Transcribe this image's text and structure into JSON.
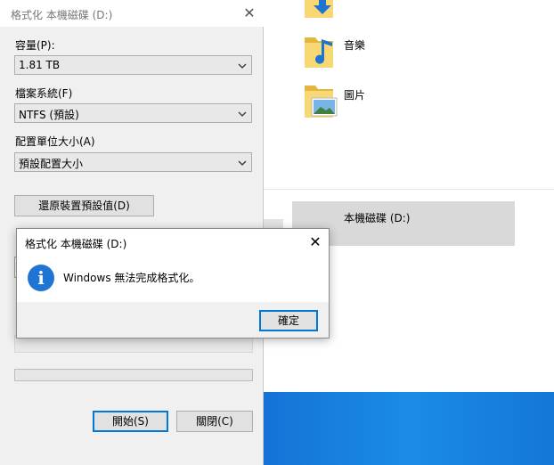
{
  "format_dialog": {
    "title": "格式化 本機磁碟 (D:)",
    "capacity_label": "容量(P):",
    "capacity_value": "1.81 TB",
    "filesystem_label": "檔案系統(F)",
    "filesystem_value": "NTFS (預設)",
    "cluster_label": "配置單位大小(A)",
    "cluster_value": "預設配置大小",
    "restore_defaults_button": "還原裝置預設值(D)",
    "start_button": "開始(S)",
    "close_button": "關閉(C)"
  },
  "message_box": {
    "title": "格式化 本機磁碟 (D:)",
    "message": "Windows 無法完成格式化。",
    "ok_button": "確定",
    "icon": "info-icon"
  },
  "explorer": {
    "folders": [
      {
        "label": "",
        "icon": "downloads-folder-icon"
      },
      {
        "label": "音樂",
        "icon": "music-folder-icon"
      },
      {
        "label": "圖片",
        "icon": "pictures-folder-icon"
      }
    ],
    "drive_label": "本機磁碟 (D:)"
  },
  "colors": {
    "accent": "#0078d7",
    "info_icon": "#1f74d4",
    "taskbar_blue": "#1a8be6"
  }
}
